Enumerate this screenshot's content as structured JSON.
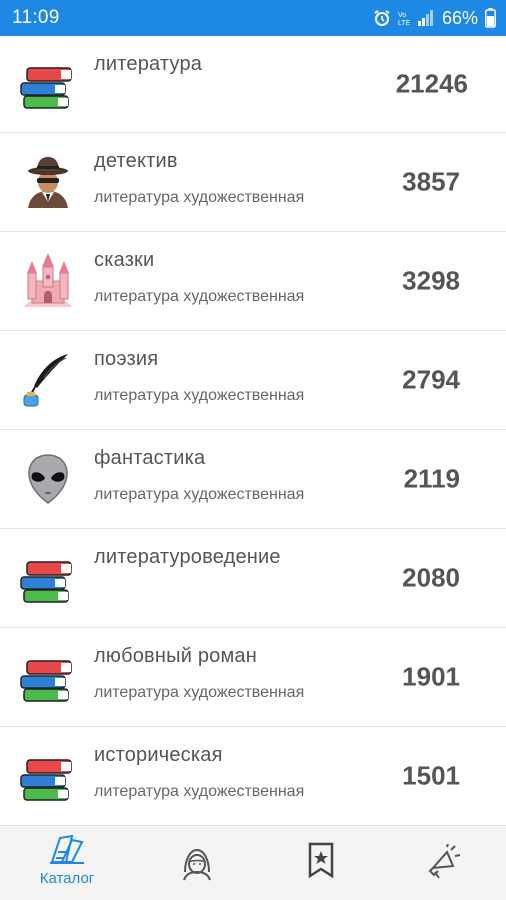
{
  "status_bar": {
    "time": "11:09",
    "battery": "66%"
  },
  "rows": [
    {
      "title": "литература",
      "subtitle": "",
      "count": "21246",
      "icon": "books-icon"
    },
    {
      "title": "детектив",
      "subtitle": "литература художественная",
      "count": "3857",
      "icon": "detective-icon"
    },
    {
      "title": "сказки",
      "subtitle": "литература художественная",
      "count": "3298",
      "icon": "castle-icon"
    },
    {
      "title": "поэзия",
      "subtitle": "литература художественная",
      "count": "2794",
      "icon": "quill-ink-icon"
    },
    {
      "title": "фантастика",
      "subtitle": "литература художественная",
      "count": "2119",
      "icon": "alien-icon"
    },
    {
      "title": "литературоведение",
      "subtitle": "",
      "count": "2080",
      "icon": "books-icon"
    },
    {
      "title": "любовный роман",
      "subtitle": "литература художественная",
      "count": "1901",
      "icon": "books-icon"
    },
    {
      "title": "историческая",
      "subtitle": "литература художественная",
      "count": "1501",
      "icon": "books-icon"
    }
  ],
  "bottom_nav": {
    "catalog_label": "Каталог",
    "accent": "#1e88e5"
  }
}
